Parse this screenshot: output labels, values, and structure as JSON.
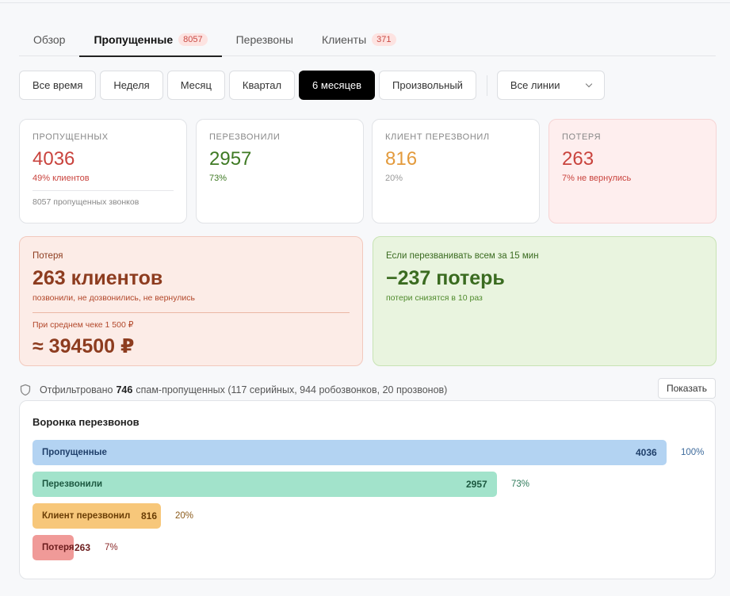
{
  "tabs": [
    {
      "label": "Обзор",
      "badge": null
    },
    {
      "label": "Пропущенные",
      "badge": "8057"
    },
    {
      "label": "Перезвоны",
      "badge": null
    },
    {
      "label": "Клиенты",
      "badge": "371"
    }
  ],
  "filters": {
    "periods": [
      "Все время",
      "Неделя",
      "Месяц",
      "Квартал",
      "6 месяцев",
      "Произвольный"
    ],
    "active_period": "6 месяцев",
    "lines_select": "Все линии"
  },
  "stats": {
    "missed": {
      "label": "ПРОПУЩЕННЫХ",
      "value": "4036",
      "sub": "49% клиентов",
      "foot": "8057 пропущенных звонков"
    },
    "called_back": {
      "label": "ПЕРЕЗВОНИЛИ",
      "value": "2957",
      "sub": "73%"
    },
    "client_called": {
      "label": "КЛИЕНТ ПЕРЕЗВОНИЛ",
      "value": "816",
      "sub": "20%"
    },
    "loss": {
      "label": "ПОТЕРЯ",
      "value": "263",
      "sub": "7% не вернулись"
    }
  },
  "loss_panel": {
    "label": "Потеря",
    "big": "263 клиентов",
    "sub": "позвонили, не дозвонились, не вернулись",
    "note": "При среднем чеке 1 500 ₽",
    "sum": "≈ 394500 ₽"
  },
  "save_panel": {
    "label": "Если перезванивать всем за 15 мин",
    "big": "−237 потерь",
    "sub": "потери снизятся в 10 раз"
  },
  "spam": {
    "prefix": "Отфильтровано",
    "count": "746",
    "suffix": "спам-пропущенных (117 серийных, 944 робозвонков, 20 прозвонов)",
    "button": "Показать"
  },
  "colors": {
    "missed": "#c9433d",
    "called_back": "#3f7a24",
    "client_called": "#e39a3c",
    "loss": "#c9433d"
  },
  "funnel": {
    "title": "Воронка перезвонов",
    "rows": [
      {
        "label": "Пропущенные",
        "value": 4036,
        "value_text": "4036",
        "percent": "100%",
        "fraction": 1.0,
        "bar": "#b3d3f2",
        "text": "#1f3f6a",
        "pct_color": "#3e6b9c"
      },
      {
        "label": "Перезвонили",
        "value": 2957,
        "value_text": "2957",
        "percent": "73%",
        "fraction": 0.7327,
        "bar": "#a2e3cb",
        "text": "#1c5840",
        "pct_color": "#2f7a5b"
      },
      {
        "label": "Клиент перезвонил",
        "value": 816,
        "value_text": "816",
        "percent": "20%",
        "fraction": 0.2022,
        "bar": "#f7c77a",
        "text": "#6a3d05",
        "pct_color": "#8a5a1a"
      },
      {
        "label": "Потеря",
        "value": 263,
        "value_text": "263",
        "percent": "7%",
        "fraction": 0.0652,
        "bar": "#f09a98",
        "text": "#6b1c1c",
        "pct_color": "#8b2a2a"
      }
    ]
  }
}
